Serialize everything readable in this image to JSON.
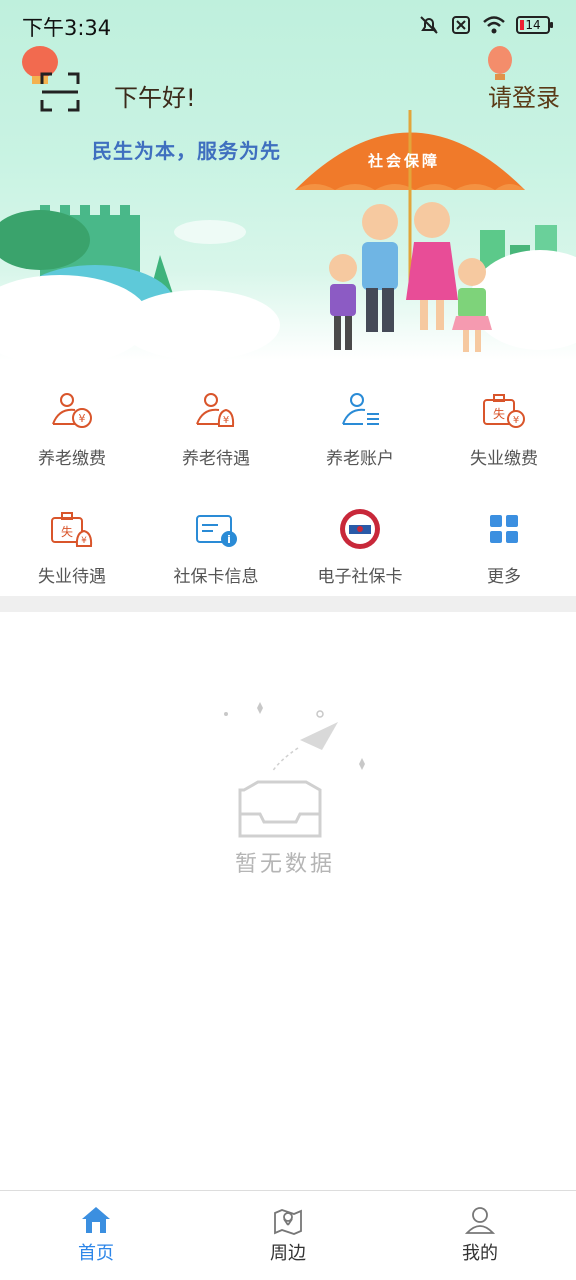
{
  "status_bar": {
    "time": "下午3:34",
    "battery": "14"
  },
  "header": {
    "greeting": "下午好!",
    "login_label": "请登录",
    "slogan": "民生为本，服务为先",
    "umbrella_text": "社会保障"
  },
  "services": [
    {
      "label": "养老缴费",
      "icon": "pension-payment-icon"
    },
    {
      "label": "养老待遇",
      "icon": "pension-benefit-icon"
    },
    {
      "label": "养老账户",
      "icon": "pension-account-icon"
    },
    {
      "label": "失业缴费",
      "icon": "unemployment-payment-icon"
    },
    {
      "label": "失业待遇",
      "icon": "unemployment-benefit-icon"
    },
    {
      "label": "社保卡信息",
      "icon": "social-card-info-icon"
    },
    {
      "label": "电子社保卡",
      "icon": "e-social-card-icon"
    },
    {
      "label": "更多",
      "icon": "more-grid-icon"
    }
  ],
  "empty_state": {
    "text": "暂无数据"
  },
  "bottom_nav": {
    "items": [
      {
        "label": "首页",
        "icon": "home-icon",
        "active": true
      },
      {
        "label": "周边",
        "icon": "map-pin-icon",
        "active": false
      },
      {
        "label": "我的",
        "icon": "user-icon",
        "active": false
      }
    ]
  },
  "colors": {
    "accent": "#2d86e8",
    "orange": "#e8642a",
    "hero_bg": "#c9f3e3"
  }
}
